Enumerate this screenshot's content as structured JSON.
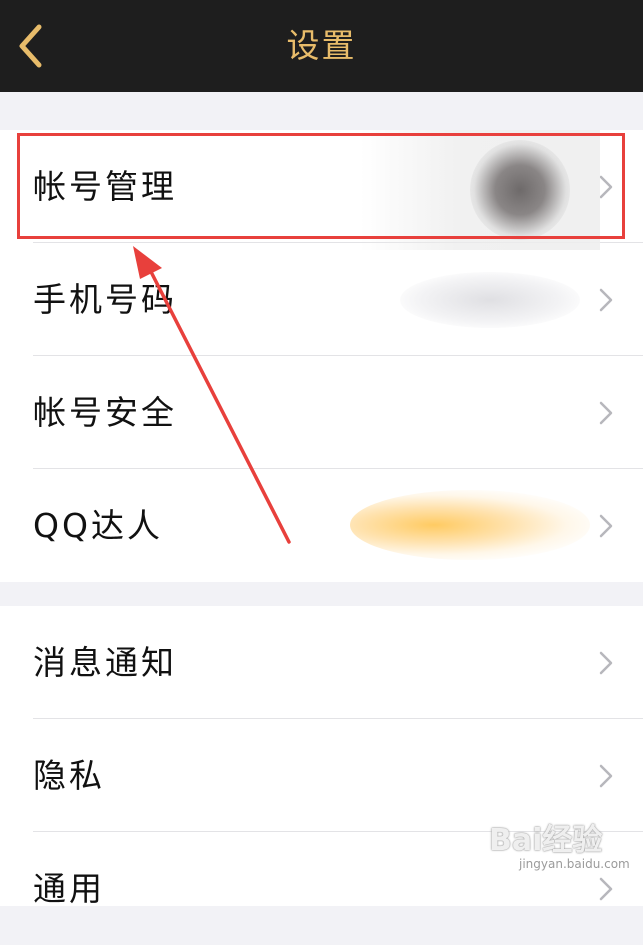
{
  "navbar": {
    "title": "设置",
    "back_icon": "chevron-left-icon",
    "colors": {
      "background": "#1e1e1e",
      "title": "#e8bc6a"
    }
  },
  "group1": {
    "items": [
      {
        "label": "帐号管理"
      },
      {
        "label": "手机号码"
      },
      {
        "label": "帐号安全"
      },
      {
        "label": "QQ达人"
      }
    ]
  },
  "group2": {
    "items": [
      {
        "label": "消息通知"
      },
      {
        "label": "隐私"
      },
      {
        "label": "通用"
      }
    ]
  },
  "row_trailing_icon": "chevron-right-icon",
  "annotation": {
    "color": "#e8403c"
  },
  "watermark": {
    "text": "Bai经验",
    "url": "jingyan.baidu.com"
  }
}
